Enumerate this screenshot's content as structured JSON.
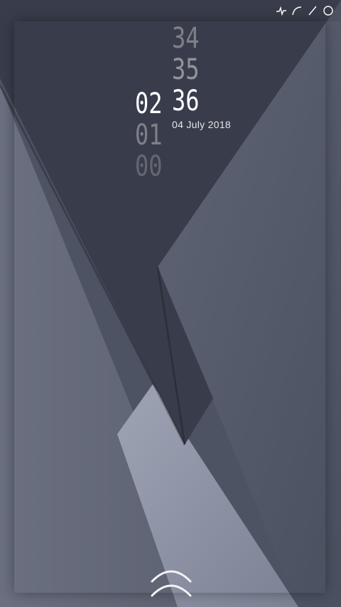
{
  "lockscreen": {
    "hours": {
      "prev": "",
      "current": "02",
      "next1": "01",
      "next2": "00"
    },
    "minutes": {
      "prev2": "34",
      "prev1": "35",
      "current": "36"
    },
    "date": "04 July 2018"
  },
  "statusbar": {
    "icons": [
      "activity-icon",
      "signal-arc-icon",
      "slash-icon",
      "circle-icon"
    ]
  },
  "colors": {
    "base": "#4b5060",
    "dark_panel": "#3a3e4c",
    "light_panel": "#8f95a6",
    "mid_panel": "#606575"
  },
  "unlock": {
    "icon": "swipe-up-chevron-icon"
  }
}
